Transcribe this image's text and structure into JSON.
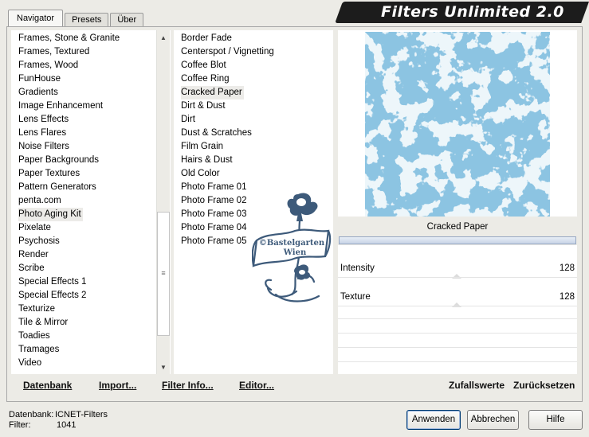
{
  "tabs": [
    "Navigator",
    "Presets",
    "Über"
  ],
  "app_title": "Filters Unlimited 2.0",
  "categories": [
    "Frames, Stone & Granite",
    "Frames, Textured",
    "Frames, Wood",
    "FunHouse",
    "Gradients",
    "Image Enhancement",
    "Lens Effects",
    "Lens Flares",
    "Noise Filters",
    "Paper Backgrounds",
    "Paper Textures",
    "Pattern Generators",
    "penta.com",
    "Photo Aging Kit",
    "Pixelate",
    "Psychosis",
    "Render",
    "Scribe",
    "Special Effects 1",
    "Special Effects 2",
    "Texturize",
    "Tile & Mirror",
    "Toadies",
    "Tramages",
    "Video"
  ],
  "selected_category": "Photo Aging Kit",
  "filters": [
    "Border Fade",
    "Centerspot / Vignetting",
    "Coffee Blot",
    "Coffee Ring",
    "Cracked Paper",
    "Dirt & Dust",
    "Dirt",
    "Dust & Scratches",
    "Film Grain",
    "Hairs & Dust",
    "Old Color",
    "Photo Frame 01",
    "Photo Frame 02",
    "Photo Frame 03",
    "Photo Frame 04",
    "Photo Frame 05"
  ],
  "selected_filter": "Cracked Paper",
  "watermark": "©Bastelgarten Wien",
  "preview_filter_name": "Cracked Paper",
  "params": [
    {
      "label": "Intensity",
      "value": "128"
    },
    {
      "label": "Texture",
      "value": "128"
    }
  ],
  "left_buttons": [
    "Datenbank",
    "Import...",
    "Filter Info...",
    "Editor..."
  ],
  "right_buttons": [
    "Zufallswerte",
    "Zurücksetzen"
  ],
  "status": {
    "db_label": "Datenbank:",
    "db_value": "ICNET-Filters",
    "filter_label": "Filter:",
    "filter_value": "1041"
  },
  "dialog_buttons": {
    "apply": "Anwenden",
    "cancel": "Abbrechen",
    "help": "Hilfe"
  },
  "colors": {
    "preview_bg": "#8cc4e2",
    "crack": "#ffffff",
    "logo": "#3d5a7a"
  }
}
